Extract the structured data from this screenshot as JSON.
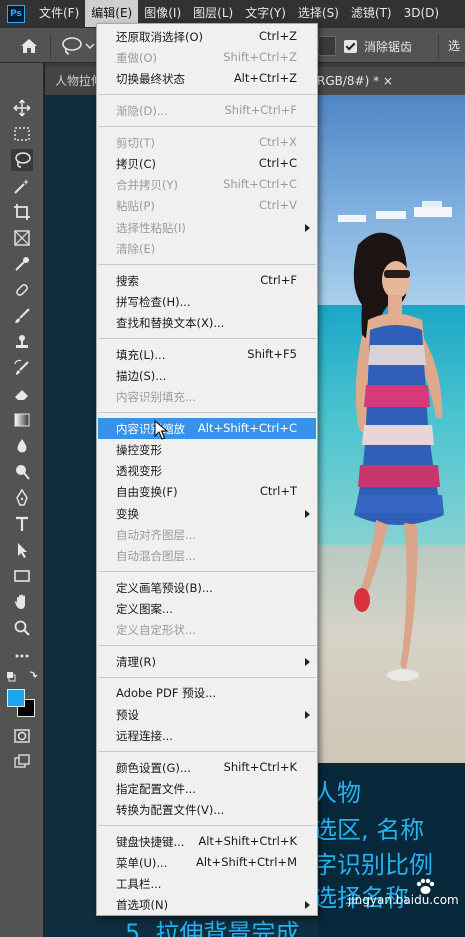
{
  "menubar": {
    "logo": "Ps",
    "items": [
      {
        "label": "文件(F)"
      },
      {
        "label": "编辑(E)"
      },
      {
        "label": "图像(I)"
      },
      {
        "label": "图层(L)"
      },
      {
        "label": "文字(Y)"
      },
      {
        "label": "选择(S)"
      },
      {
        "label": "滤镜(T)"
      },
      {
        "label": "3D(D)"
      }
    ]
  },
  "options": {
    "anti_alias_label": "消除锯齿",
    "more_label": "选"
  },
  "tabs": [
    {
      "label": "人物拉伸"
    },
    {
      "label": "RGB/8#) *  ×"
    }
  ],
  "edit_menu": {
    "groups": [
      [
        {
          "label": "还原取消选择(O)",
          "shortcut": "Ctrl+Z",
          "enabled": true
        },
        {
          "label": "重做(O)",
          "shortcut": "Shift+Ctrl+Z",
          "enabled": false
        },
        {
          "label": "切换最终状态",
          "shortcut": "Alt+Ctrl+Z",
          "enabled": true
        }
      ],
      [
        {
          "label": "渐隐(D)...",
          "shortcut": "Shift+Ctrl+F",
          "enabled": false
        }
      ],
      [
        {
          "label": "剪切(T)",
          "shortcut": "Ctrl+X",
          "enabled": false
        },
        {
          "label": "拷贝(C)",
          "shortcut": "Ctrl+C",
          "enabled": true
        },
        {
          "label": "合并拷贝(Y)",
          "shortcut": "Shift+Ctrl+C",
          "enabled": false
        },
        {
          "label": "粘贴(P)",
          "shortcut": "Ctrl+V",
          "enabled": false
        },
        {
          "label": "选择性粘贴(I)",
          "shortcut": "",
          "enabled": false,
          "submenu": true
        },
        {
          "label": "清除(E)",
          "shortcut": "",
          "enabled": false
        }
      ],
      [
        {
          "label": "搜索",
          "shortcut": "Ctrl+F",
          "enabled": true
        },
        {
          "label": "拼写检查(H)...",
          "shortcut": "",
          "enabled": true
        },
        {
          "label": "查找和替换文本(X)...",
          "shortcut": "",
          "enabled": true
        }
      ],
      [
        {
          "label": "填充(L)...",
          "shortcut": "Shift+F5",
          "enabled": true
        },
        {
          "label": "描边(S)...",
          "shortcut": "",
          "enabled": true
        },
        {
          "label": "内容识别填充...",
          "shortcut": "",
          "enabled": false
        }
      ],
      [
        {
          "label": "内容识别缩放",
          "shortcut": "Alt+Shift+Ctrl+C",
          "enabled": true,
          "highlighted": true
        },
        {
          "label": "操控变形",
          "shortcut": "",
          "enabled": true
        },
        {
          "label": "透视变形",
          "shortcut": "",
          "enabled": true
        },
        {
          "label": "自由变换(F)",
          "shortcut": "Ctrl+T",
          "enabled": true
        },
        {
          "label": "变换",
          "shortcut": "",
          "enabled": true,
          "submenu": true
        },
        {
          "label": "自动对齐图层...",
          "shortcut": "",
          "enabled": false
        },
        {
          "label": "自动混合图层...",
          "shortcut": "",
          "enabled": false
        }
      ],
      [
        {
          "label": "定义画笔预设(B)...",
          "shortcut": "",
          "enabled": true
        },
        {
          "label": "定义图案...",
          "shortcut": "",
          "enabled": true
        },
        {
          "label": "定义自定形状...",
          "shortcut": "",
          "enabled": false
        }
      ],
      [
        {
          "label": "清理(R)",
          "shortcut": "",
          "enabled": true,
          "submenu": true
        }
      ],
      [
        {
          "label": "Adobe PDF 预设...",
          "shortcut": "",
          "enabled": true
        },
        {
          "label": "预设",
          "shortcut": "",
          "enabled": true,
          "submenu": true
        },
        {
          "label": "远程连接...",
          "shortcut": "",
          "enabled": true
        }
      ],
      [
        {
          "label": "颜色设置(G)...",
          "shortcut": "Shift+Ctrl+K",
          "enabled": true
        },
        {
          "label": "指定配置文件...",
          "shortcut": "",
          "enabled": true
        },
        {
          "label": "转换为配置文件(V)...",
          "shortcut": "",
          "enabled": true
        }
      ],
      [
        {
          "label": "键盘快捷键...",
          "shortcut": "Alt+Shift+Ctrl+K",
          "enabled": true
        },
        {
          "label": "菜单(U)...",
          "shortcut": "Alt+Shift+Ctrl+M",
          "enabled": true
        },
        {
          "label": "工具栏...",
          "shortcut": "",
          "enabled": true
        },
        {
          "label": "首选项(N)",
          "shortcut": "",
          "enabled": true,
          "submenu": true
        }
      ]
    ]
  },
  "caption": {
    "lines": [
      "人物",
      "选区, 名称",
      "字识别比例",
      "选择名称",
      "5. 拉伸背景完成"
    ]
  },
  "colors": {
    "foreground": "#1aa6ef",
    "background": "#000000",
    "highlight": "#3793ea",
    "caption": "#26b2f0"
  },
  "watermark": "jingyan.baidu.com"
}
